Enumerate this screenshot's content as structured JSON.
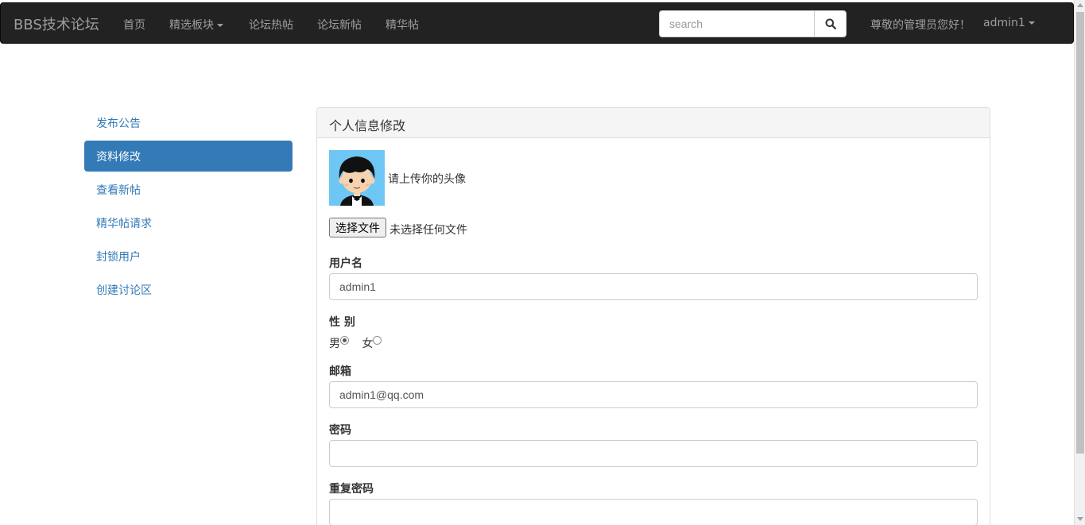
{
  "navbar": {
    "brand": "BBS技术论坛",
    "links": [
      "首页",
      "精选板块",
      "论坛热帖",
      "论坛新帖",
      "精华帖"
    ],
    "search_placeholder": "search",
    "greeting": "尊敬的管理员您好！",
    "user": "admin1"
  },
  "sidebar": {
    "items": [
      {
        "label": "发布公告",
        "active": false
      },
      {
        "label": "资料修改",
        "active": true
      },
      {
        "label": "查看新帖",
        "active": false
      },
      {
        "label": "精华帖请求",
        "active": false
      },
      {
        "label": "封锁用户",
        "active": false
      },
      {
        "label": "创建讨论区",
        "active": false
      }
    ]
  },
  "panel": {
    "title": "个人信息修改",
    "avatar_hint": "请上传你的头像",
    "file_button": "选择文件",
    "file_status": "未选择任何文件",
    "username_label": "用户名",
    "username_value": "admin1",
    "gender_label": "性 别",
    "gender_male": "男",
    "gender_female": "女",
    "gender_selected": "男",
    "email_label": "邮箱",
    "email_value": "admin1@qq.com",
    "password_label": "密码",
    "password_value": "",
    "repeat_password_label": "重复密码",
    "repeat_password_value": ""
  },
  "colors": {
    "navbar_bg": "#222222",
    "nav_text": "#9d9d9d",
    "accent": "#337ab7"
  }
}
